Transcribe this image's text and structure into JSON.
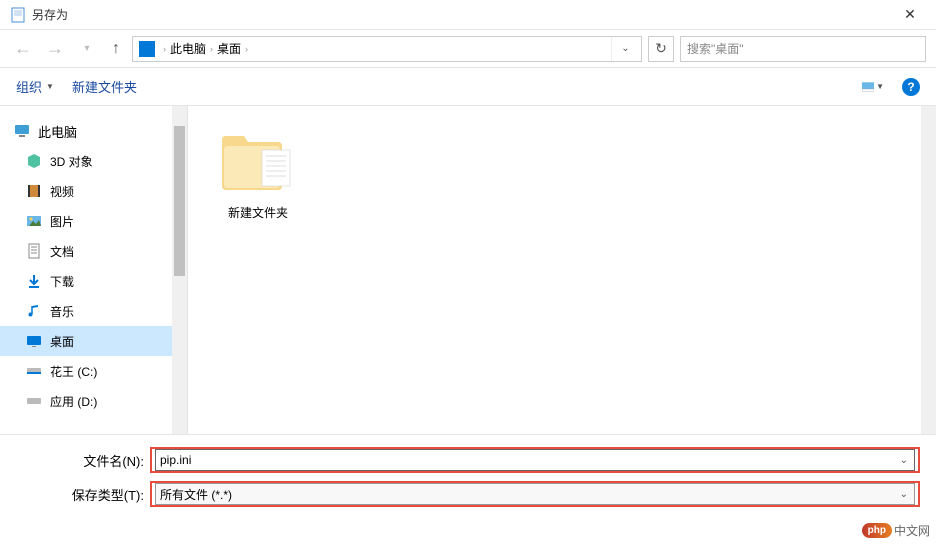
{
  "window": {
    "title": "另存为"
  },
  "breadcrumb": {
    "root": "此电脑",
    "current": "桌面"
  },
  "search": {
    "placeholder": "搜索\"桌面\""
  },
  "toolbar": {
    "organize": "组织",
    "newFolder": "新建文件夹"
  },
  "sidebar": {
    "root": "此电脑",
    "items": [
      {
        "label": "3D 对象"
      },
      {
        "label": "视频"
      },
      {
        "label": "图片"
      },
      {
        "label": "文档"
      },
      {
        "label": "下载"
      },
      {
        "label": "音乐"
      },
      {
        "label": "桌面"
      },
      {
        "label": "花王 (C:)"
      },
      {
        "label": "应用 (D:)"
      }
    ]
  },
  "content": {
    "folderName": "新建文件夹"
  },
  "footer": {
    "filenameLabel": "文件名(N):",
    "filename": "pip.ini",
    "typeLabel": "保存类型(T):",
    "type": "所有文件  (*.*)"
  },
  "watermark": {
    "badge": "php",
    "text": "中文网"
  }
}
